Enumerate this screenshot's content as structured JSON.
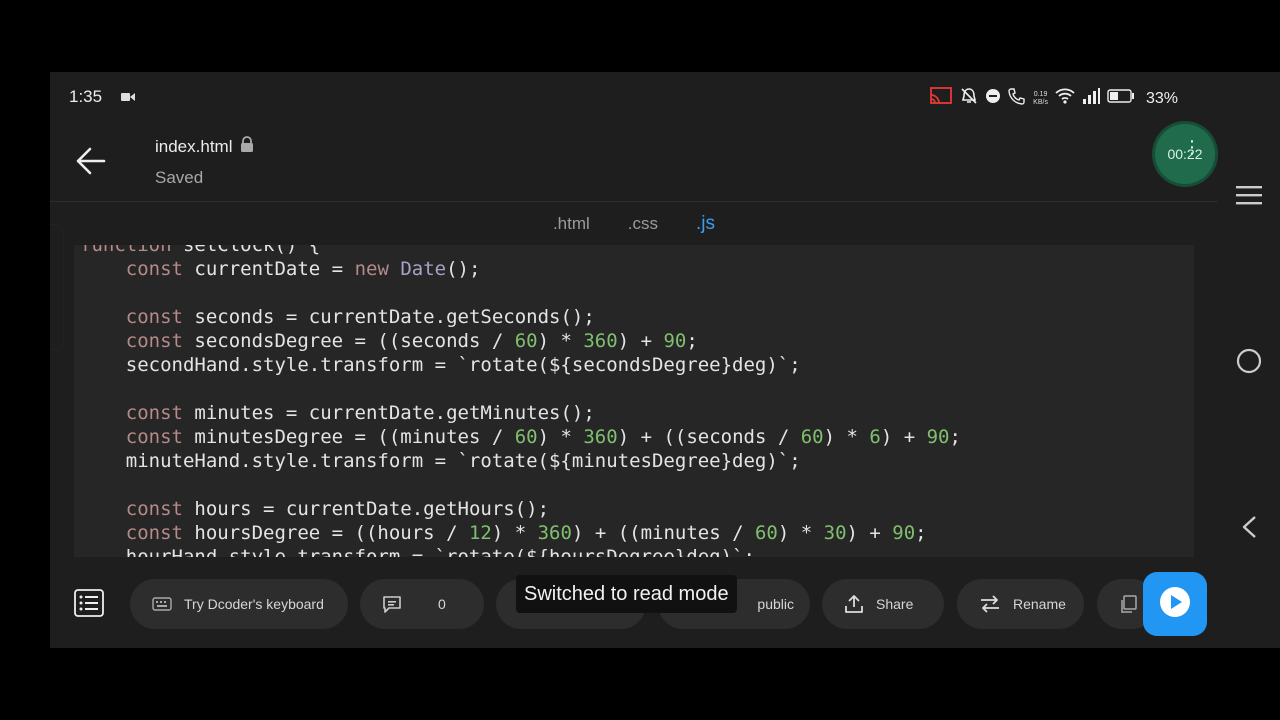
{
  "status_bar": {
    "time": "1:35",
    "net_speed_value": "0.19",
    "net_speed_unit": "KB/s",
    "battery": "33%"
  },
  "header": {
    "file_name": "index.html",
    "save_status": "Saved",
    "timer": "00:22"
  },
  "tabs": [
    {
      "label": ".html",
      "active": false
    },
    {
      "label": ".css",
      "active": false
    },
    {
      "label": ".js",
      "active": true
    }
  ],
  "editor": {
    "language": "js",
    "lines": [
      "function setClock() {",
      "    const currentDate = new Date();",
      "",
      "    const seconds = currentDate.getSeconds();",
      "    const secondsDegree = ((seconds / 60) * 360) + 90;",
      "    secondHand.style.transform = `rotate(${secondsDegree}deg)`;",
      "",
      "    const minutes = currentDate.getMinutes();",
      "    const minutesDegree = ((minutes / 60) * 360) + ((seconds / 60) * 6) + 90;",
      "    minuteHand.style.transform = `rotate(${minutesDegree}deg)`;",
      "",
      "    const hours = currentDate.getHours();",
      "    const hoursDegree = ((hours / 12) * 360) + ((minutes / 60) * 30) + 90;",
      "    hourHand.style.transform = `rotate(${hoursDegree}deg)`;"
    ]
  },
  "toolbar": {
    "keyboard_label": "Try Dcoder's keyboard",
    "comments_count": "0",
    "visibility_label": "public",
    "share_label": "Share",
    "rename_label": "Rename",
    "toast": "Switched to read mode"
  },
  "colors": {
    "accent": "#2196f3",
    "active_tab": "#3b9cf0",
    "keyword": "#b58a8a",
    "number": "#7fbf6e",
    "timer_bg": "#1f6b4c"
  }
}
